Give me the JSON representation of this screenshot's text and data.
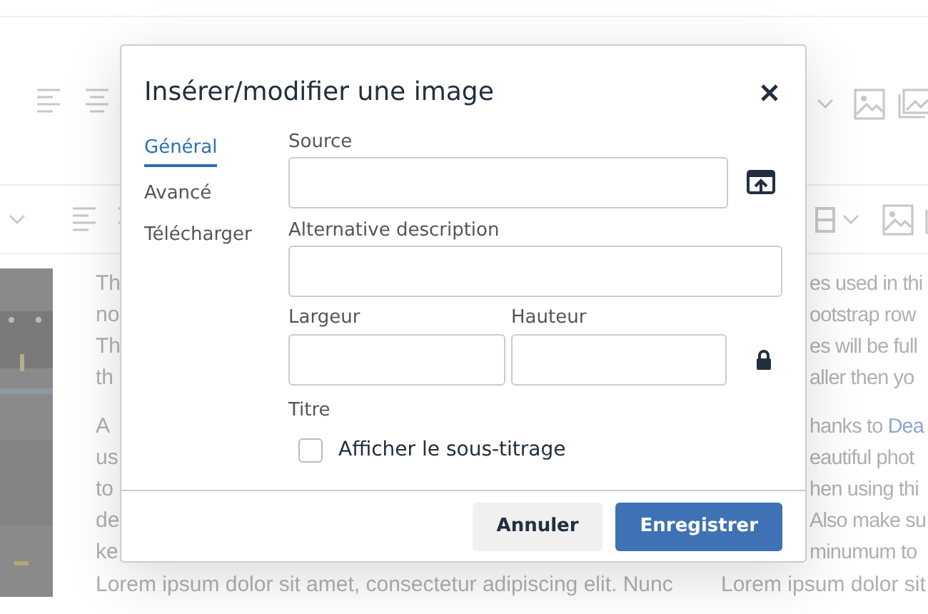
{
  "background": {
    "left_paragraphs": [
      [
        {
          "text": "Th"
        },
        {
          "text": "no"
        },
        {
          "text": "Th"
        },
        {
          "text": "th"
        }
      ],
      [
        {
          "text": "A"
        },
        {
          "text": "us"
        },
        {
          "text": "to"
        },
        {
          "text": "de"
        },
        {
          "text": "ke"
        }
      ]
    ],
    "right_paragraphs": [
      [
        {
          "text": "es used in thi"
        },
        {
          "text": "ootstrap row"
        },
        {
          "text": "es will be full"
        },
        {
          "text": "aller then yo"
        }
      ],
      [
        {
          "text": "hanks to ",
          "link": "Dea"
        },
        {
          "text": "eautiful phot"
        },
        {
          "text": "hen using thi"
        },
        {
          "text": "Also make su"
        },
        {
          "text": "minumum to"
        }
      ]
    ],
    "bottom_left": "Lorem ipsum dolor sit amet, consectetur adipiscing elit. Nunc",
    "bottom_right": "Lorem ipsum dolor sit"
  },
  "dialog": {
    "title": "Insérer/modifier une image",
    "tabs": [
      {
        "label": "Général",
        "selected": true
      },
      {
        "label": "Avancé",
        "selected": false
      },
      {
        "label": "Télécharger",
        "selected": false
      }
    ],
    "source": {
      "label": "Source"
    },
    "alt": {
      "label": "Alternative description"
    },
    "dimensions": {
      "width_label": "Largeur",
      "height_label": "Hauteur",
      "locked": true
    },
    "title_label": "Titre",
    "caption": {
      "label": "Afficher le sous-titrage",
      "checked": false
    },
    "buttons": [
      {
        "label": "Annuler",
        "kind": "secondary"
      },
      {
        "label": "Enregistrer",
        "kind": "primary"
      }
    ]
  }
}
